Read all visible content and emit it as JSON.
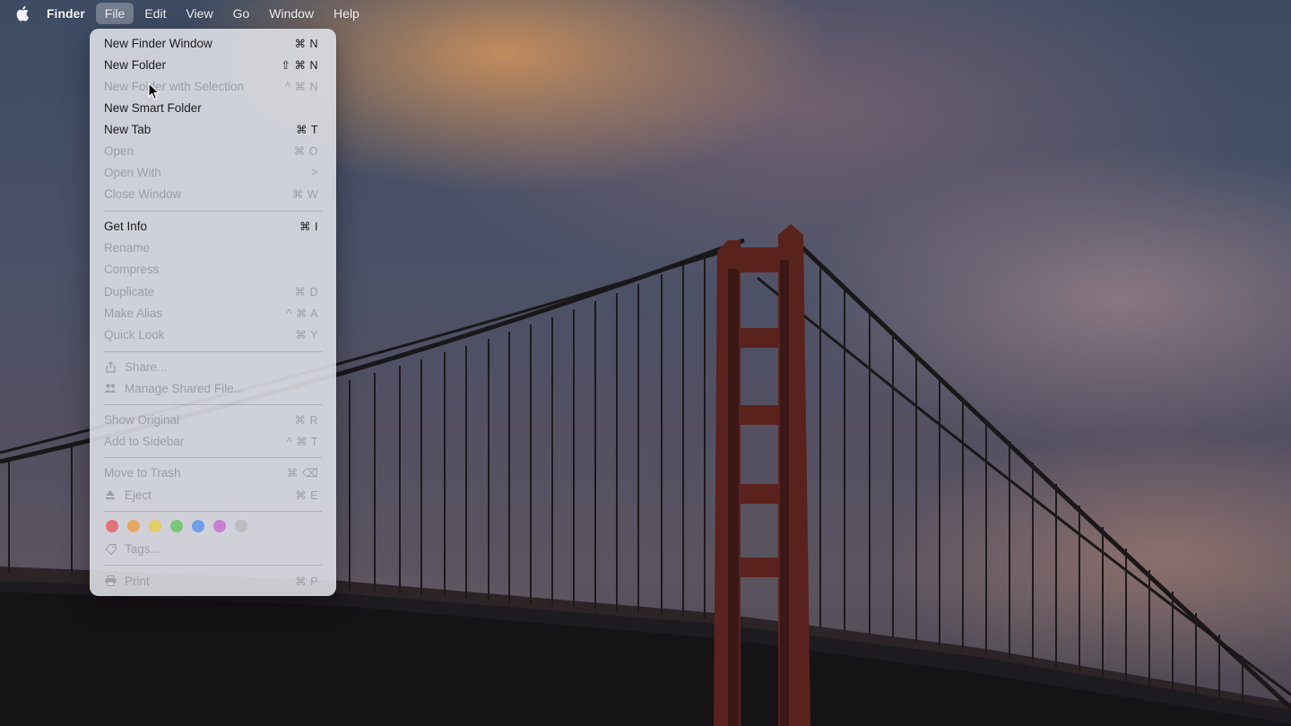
{
  "menubar": {
    "apple_icon": "apple-icon",
    "app_name": "Finder",
    "items": [
      "File",
      "Edit",
      "View",
      "Go",
      "Window",
      "Help"
    ],
    "active": "File"
  },
  "file_menu": {
    "new_finder_window": {
      "label": "New Finder Window",
      "shortcut": "⌘ N"
    },
    "new_folder": {
      "label": "New Folder",
      "shortcut": "⇧ ⌘ N"
    },
    "new_folder_selection": {
      "label": "New Folder with Selection",
      "shortcut": "^ ⌘ N"
    },
    "new_smart_folder": {
      "label": "New Smart Folder",
      "shortcut": ""
    },
    "new_tab": {
      "label": "New Tab",
      "shortcut": "⌘ T"
    },
    "open": {
      "label": "Open",
      "shortcut": "⌘ O"
    },
    "open_with": {
      "label": "Open With",
      "shortcut": ">"
    },
    "close_window": {
      "label": "Close Window",
      "shortcut": "⌘ W"
    },
    "get_info": {
      "label": "Get Info",
      "shortcut": "⌘  I"
    },
    "rename": {
      "label": "Rename",
      "shortcut": ""
    },
    "compress": {
      "label": "Compress",
      "shortcut": ""
    },
    "duplicate": {
      "label": "Duplicate",
      "shortcut": "⌘ D"
    },
    "make_alias": {
      "label": "Make Alias",
      "shortcut": "^ ⌘ A"
    },
    "quick_look": {
      "label": "Quick Look",
      "shortcut": "⌘ Y"
    },
    "share": {
      "label": "Share...",
      "shortcut": ""
    },
    "manage_shared": {
      "label": "Manage Shared File...",
      "shortcut": ""
    },
    "show_original": {
      "label": "Show Original",
      "shortcut": "⌘ R"
    },
    "add_to_sidebar": {
      "label": "Add to Sidebar",
      "shortcut": "^ ⌘ T"
    },
    "move_to_trash": {
      "label": "Move to Trash",
      "shortcut": "⌘ ⌫"
    },
    "eject": {
      "label": "Eject",
      "shortcut": "⌘ E"
    },
    "tags": {
      "label": "Tags...",
      "shortcut": ""
    },
    "print": {
      "label": "Print",
      "shortcut": "⌘ P"
    },
    "tag_colors": [
      "#e8535a",
      "#ef9a3e",
      "#e8c93c",
      "#5ec25a",
      "#4f8df0",
      "#c463d2",
      "#b5b5ba"
    ]
  }
}
